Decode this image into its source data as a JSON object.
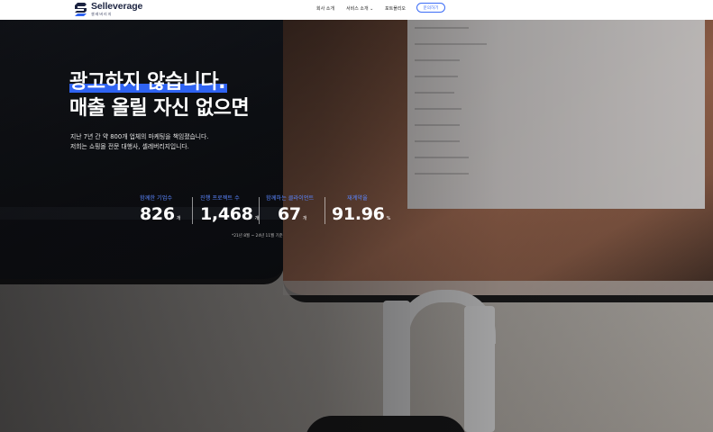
{
  "brand": {
    "name": "Selleverage",
    "sub": "셀레버리지",
    "accent": "#2f63f2",
    "logo_mark_color": "#2f63f2"
  },
  "nav": {
    "items": [
      {
        "label": "회사 소개"
      },
      {
        "label": "서비스 소개 ⌄"
      },
      {
        "label": "포트폴리오"
      }
    ],
    "cta": "문의하기"
  },
  "hero": {
    "headline_1": "광고하지 않습니다.",
    "headline_2": "매출 올릴 자신 없으면",
    "desc_1": "지난 7년 간 약 800개 업체의 마케팅을 책임졌습니다.",
    "desc_2": "저희는 쇼핑몰 전문 대행사, 셀레버리지입니다."
  },
  "stats": {
    "items": [
      {
        "label": "함께한 기업수",
        "value": "826",
        "unit": "개"
      },
      {
        "label": "진행 프로젝트 수",
        "value": "1,468",
        "unit": "개"
      },
      {
        "label": "함께하는 클라이언트",
        "value": "67",
        "unit": "개"
      },
      {
        "label": "재계약율",
        "value": "91.96",
        "unit": "%"
      }
    ],
    "note": "*21년 8월 ~ 24년 11월 기준"
  }
}
